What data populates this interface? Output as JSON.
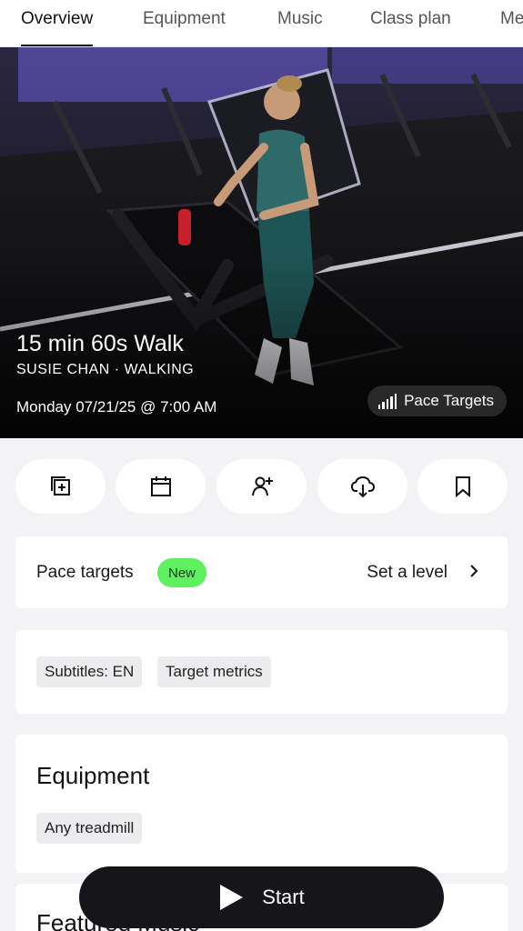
{
  "tabs": [
    {
      "label": "Overview",
      "active": true
    },
    {
      "label": "Equipment",
      "active": false
    },
    {
      "label": "Music",
      "active": false
    },
    {
      "label": "Class plan",
      "active": false
    },
    {
      "label": "Me",
      "active": false
    }
  ],
  "hero": {
    "title": "15 min 60s Walk",
    "subtitle": "SUSIE CHAN · WALKING",
    "datetime": "Monday 07/21/25 @ 7:00 AM",
    "pace_chip_label": "Pace Targets",
    "pace_chip_icon": "signal-bars-icon"
  },
  "actions": [
    {
      "name": "add-to-stack-button",
      "icon": "add-stack-icon"
    },
    {
      "name": "schedule-button",
      "icon": "calendar-icon"
    },
    {
      "name": "invite-friends-button",
      "icon": "add-person-icon"
    },
    {
      "name": "download-button",
      "icon": "cloud-download-icon"
    },
    {
      "name": "bookmark-button",
      "icon": "bookmark-icon"
    }
  ],
  "pace_targets": {
    "label": "Pace targets",
    "badge": "New",
    "badge_color": "#5ef05e",
    "action": "Set a level"
  },
  "features": {
    "tags": [
      "Subtitles: EN",
      "Target metrics"
    ]
  },
  "equipment": {
    "title": "Equipment",
    "tags": [
      "Any treadmill"
    ]
  },
  "featured": {
    "title": "Featured Music"
  },
  "start": {
    "label": "Start"
  }
}
